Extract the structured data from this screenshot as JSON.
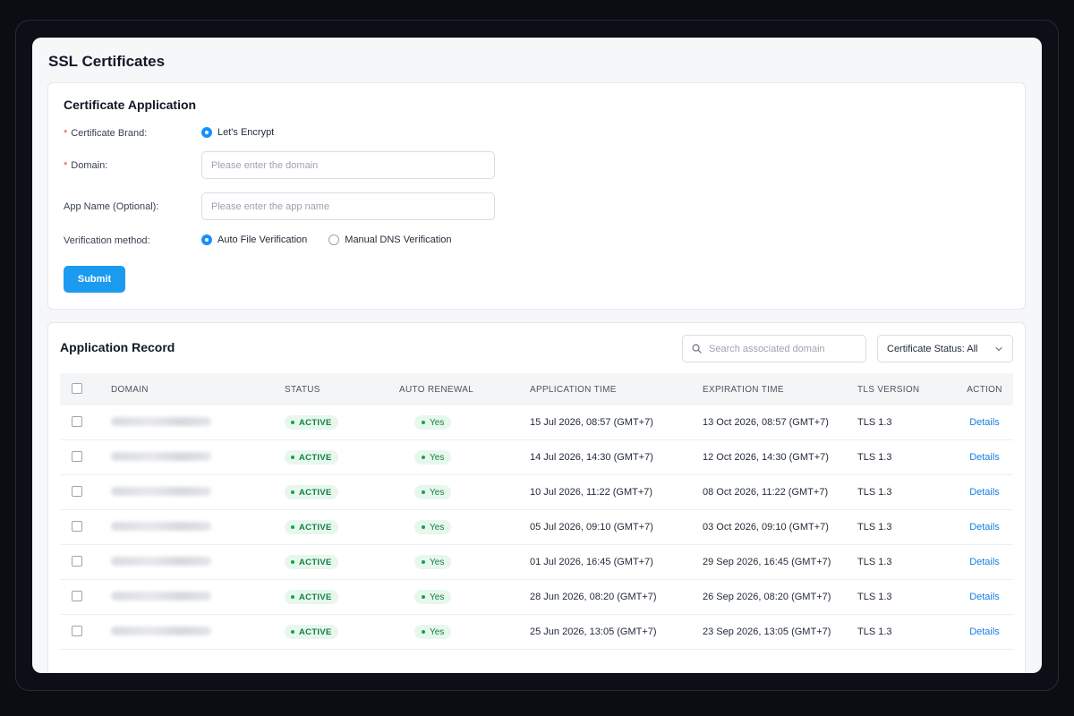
{
  "page": {
    "title": "SSL Certificates"
  },
  "application": {
    "title": "Certificate Application",
    "brand_label": "Certificate Brand:",
    "brand_option": "Let's Encrypt",
    "domain_label": "Domain:",
    "domain_placeholder": "Please enter the domain",
    "app_name_label": "App Name (Optional):",
    "app_name_placeholder": "Please enter the app name",
    "verification_label": "Verification method:",
    "verification_options": [
      "Auto File Verification",
      "Manual DNS Verification"
    ],
    "verification_selected": "Auto File Verification",
    "submit_label": "Submit",
    "required_mark": "*"
  },
  "records": {
    "title": "Application Record",
    "search_placeholder": "Search associated domain",
    "status_filter": "Certificate Status: All",
    "columns": [
      "DOMAIN",
      "STATUS",
      "AUTO RENEWAL",
      "APPLICATION TIME",
      "EXPIRATION TIME",
      "TLS VERSION",
      "ACTION"
    ],
    "rows": [
      {
        "status": "ACTIVE",
        "auto_renewal": "Yes",
        "application_time": "15 Jul 2026, 08:57 (GMT+7)",
        "expiration_time": "13 Oct 2026, 08:57 (GMT+7)",
        "tls": "TLS 1.3",
        "action": "Details"
      },
      {
        "status": "ACTIVE",
        "auto_renewal": "Yes",
        "application_time": "14 Jul 2026, 14:30 (GMT+7)",
        "expiration_time": "12 Oct 2026, 14:30 (GMT+7)",
        "tls": "TLS 1.3",
        "action": "Details"
      },
      {
        "status": "ACTIVE",
        "auto_renewal": "Yes",
        "application_time": "10 Jul 2026, 11:22 (GMT+7)",
        "expiration_time": "08 Oct 2026, 11:22 (GMT+7)",
        "tls": "TLS 1.3",
        "action": "Details"
      },
      {
        "status": "ACTIVE",
        "auto_renewal": "Yes",
        "application_time": "05 Jul 2026, 09:10 (GMT+7)",
        "expiration_time": "03 Oct 2026, 09:10 (GMT+7)",
        "tls": "TLS 1.3",
        "action": "Details"
      },
      {
        "status": "ACTIVE",
        "auto_renewal": "Yes",
        "application_time": "01 Jul 2026, 16:45 (GMT+7)",
        "expiration_time": "29 Sep 2026, 16:45 (GMT+7)",
        "tls": "TLS 1.3",
        "action": "Details"
      },
      {
        "status": "ACTIVE",
        "auto_renewal": "Yes",
        "application_time": "28 Jun 2026, 08:20 (GMT+7)",
        "expiration_time": "26 Sep 2026, 08:20 (GMT+7)",
        "tls": "TLS 1.3",
        "action": "Details"
      },
      {
        "status": "ACTIVE",
        "auto_renewal": "Yes",
        "application_time": "25 Jun 2026, 13:05 (GMT+7)",
        "expiration_time": "23 Sep 2026, 13:05 (GMT+7)",
        "tls": "TLS 1.3",
        "action": "Details"
      }
    ]
  },
  "colors": {
    "accent": "#1a9bf0",
    "link": "#1a7fe0",
    "active_bg": "#e7f7ee",
    "active_text": "#15803d",
    "required": "#ef4444"
  },
  "icons": {
    "search": "search-icon",
    "dropdown": "chevron-down-icon"
  }
}
